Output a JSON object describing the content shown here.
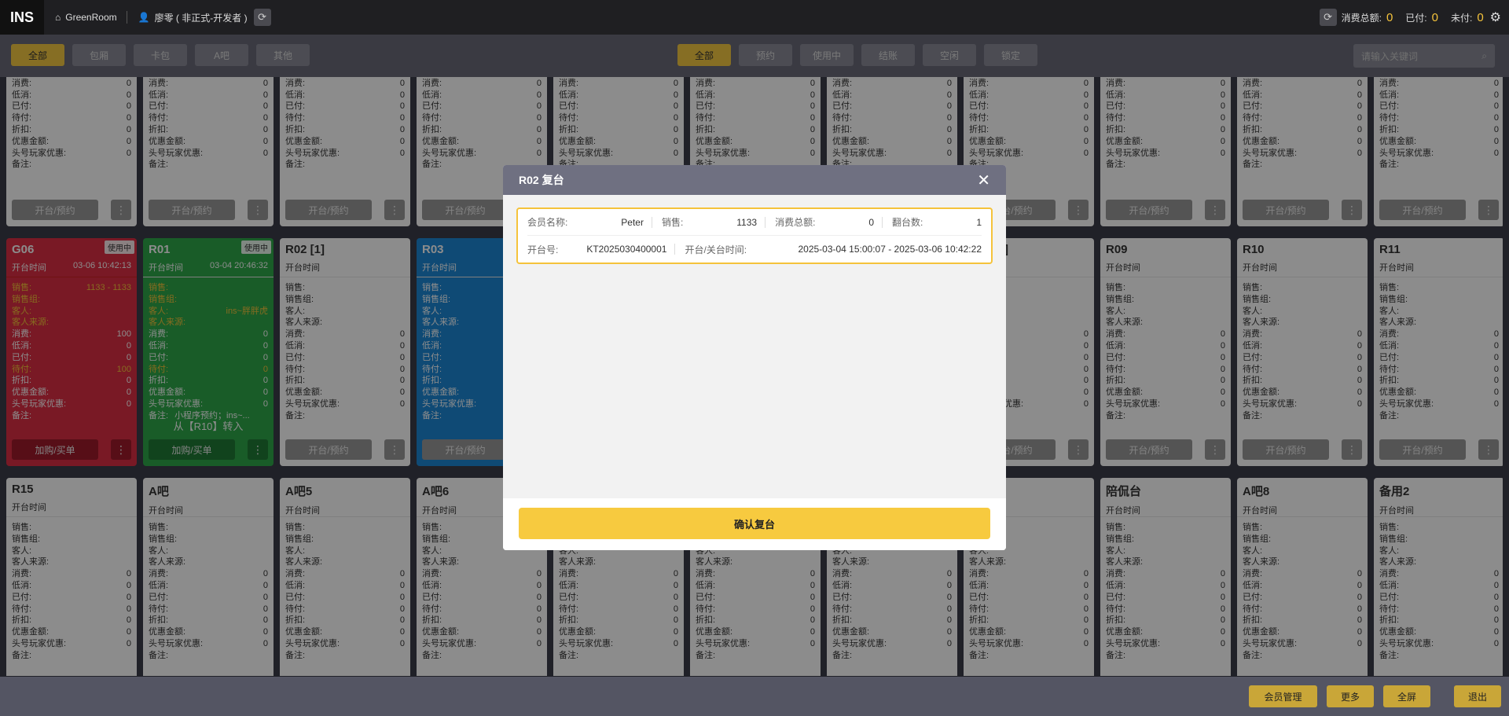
{
  "topbar": {
    "logo": "INS",
    "store": "GreenRoom",
    "user": "廖零 ( 非正式-开发者 )",
    "total_label": "消费总额:",
    "total_value": "0",
    "paid_label": "已付:",
    "paid_value": "0",
    "unpaid_label": "未付:",
    "unpaid_value": "0"
  },
  "filters": {
    "type_tabs": [
      "全部",
      "包厢",
      "卡包",
      "A吧",
      "其他"
    ],
    "status_tabs": [
      "全部",
      "预约",
      "使用中",
      "结账",
      "空闲",
      "锁定"
    ],
    "search_placeholder": "请输入关键词"
  },
  "card_labels": {
    "open_time": "开台时间",
    "sales": "销售:",
    "sales_group": "销售组:",
    "guest": "客人:",
    "source": "客人来源:",
    "consume": "消费:",
    "min_consume": "低消:",
    "paid": "已付:",
    "pending": "待付:",
    "discount": "折扣:",
    "coupon": "优惠金额:",
    "vip": "头号玩家优惠:",
    "remark": "备注:",
    "open_btn": "开台/预约",
    "add_btn": "加购/买单",
    "in_use": "使用中",
    "more": "⋮",
    "zero": "0"
  },
  "cards_special": {
    "g06": {
      "name": "G06",
      "badge": "使用中",
      "time": "03-06 10:42:13",
      "sales": "1133 - 1133",
      "consume": "100",
      "pending": "100"
    },
    "r01": {
      "name": "R01",
      "badge": "使用中",
      "time": "03-04 20:46:32",
      "guest": "ins~胖胖虎",
      "remark": "小程序预约；ins~...",
      "transfer": "从【R10】转入"
    },
    "r02": {
      "name": "R02 [1]"
    },
    "r03": {
      "name": "R03"
    }
  },
  "row2_names": [
    "R09",
    "R10",
    "R11"
  ],
  "row3_names": [
    "R15",
    "A吧",
    "A吧5",
    "A吧6",
    "陪侃台",
    "A吧8",
    "备用2"
  ],
  "modal": {
    "title": "R02 复台",
    "close": "✕",
    "member_label": "会员名称:",
    "member_value": "Peter",
    "sales_label": "销售:",
    "sales_value": "1133",
    "total_label": "消费总额:",
    "total_value": "0",
    "turns_label": "翻台数:",
    "turns_value": "1",
    "order_label": "开台号:",
    "order_value": "KT2025030400001",
    "time_label": "开台/关台时间:",
    "time_value": "2025-03-04 15:00:07 - 2025-03-06 10:42:22",
    "confirm": "确认复台"
  },
  "bottom": [
    "会员管理",
    "更多",
    "全屏",
    "退出"
  ]
}
